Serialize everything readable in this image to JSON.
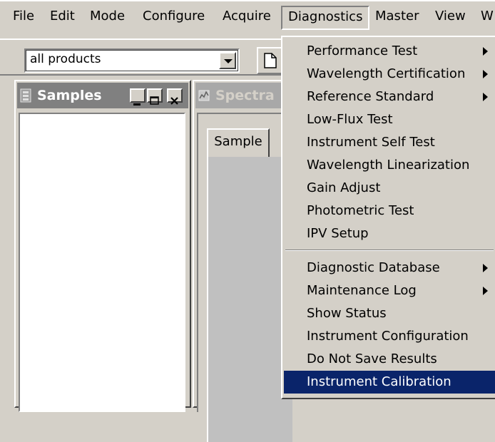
{
  "menubar": {
    "items": [
      "File",
      "Edit",
      "Mode",
      "Configure",
      "Acquire",
      "Diagnostics",
      "Master",
      "View",
      "W"
    ]
  },
  "toolbar": {
    "combo_value": "all products"
  },
  "samples_window": {
    "title": "Samples"
  },
  "spectra_window": {
    "title": "Spectra",
    "tab": "Sample"
  },
  "diagnostics_menu": {
    "items": [
      {
        "label": "Performance Test",
        "submenu": true
      },
      {
        "label": "Wavelength Certification",
        "submenu": true
      },
      {
        "label": "Reference Standard",
        "submenu": true
      },
      {
        "label": "Low-Flux Test",
        "submenu": false
      },
      {
        "label": "Instrument Self Test",
        "submenu": false
      },
      {
        "label": "Wavelength Linearization",
        "submenu": false
      },
      {
        "label": "Gain Adjust",
        "submenu": false
      },
      {
        "label": "Photometric Test",
        "submenu": false
      },
      {
        "label": "IPV Setup",
        "submenu": false
      },
      {
        "label": "Diagnostic Database",
        "submenu": true
      },
      {
        "label": "Maintenance Log",
        "submenu": true
      },
      {
        "label": "Show Status",
        "submenu": false
      },
      {
        "label": "Instrument Configuration",
        "submenu": false
      },
      {
        "label": "Do Not Save Results",
        "submenu": false
      },
      {
        "label": "Instrument Calibration",
        "submenu": false,
        "highlighted": true
      }
    ]
  },
  "colors": {
    "face": "#d4d0c8",
    "highlight": "#0a246a",
    "active_title": "#808080"
  }
}
